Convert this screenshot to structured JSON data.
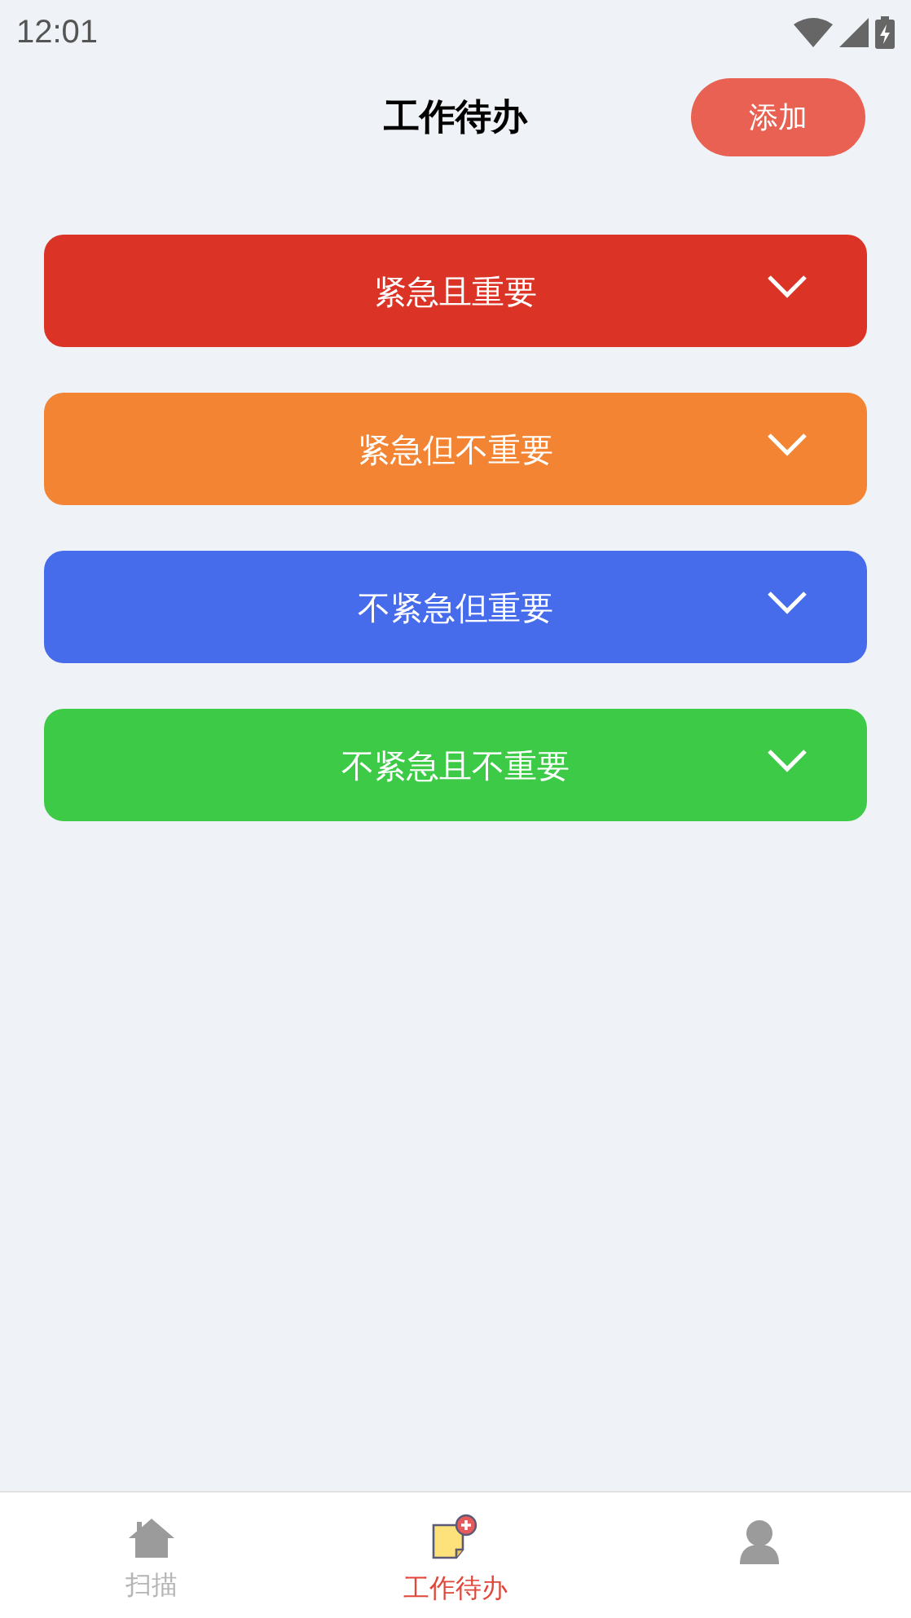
{
  "status_bar": {
    "time": "12:01"
  },
  "header": {
    "title": "工作待办",
    "add_button": "添加"
  },
  "categories": [
    {
      "label": "紧急且重要",
      "color": "#db3427",
      "expanded": false
    },
    {
      "label": "紧急但不重要",
      "color": "#f28433",
      "expanded": false
    },
    {
      "label": "不紧急但重要",
      "color": "#466beb",
      "expanded": false
    },
    {
      "label": "不紧急且不重要",
      "color": "#3dca46",
      "expanded": false
    }
  ],
  "tab_bar": [
    {
      "kind": "home",
      "label": "扫描",
      "selected": false
    },
    {
      "kind": "todo",
      "label": "工作待办",
      "selected": true
    },
    {
      "kind": "profile",
      "selected": false
    }
  ]
}
